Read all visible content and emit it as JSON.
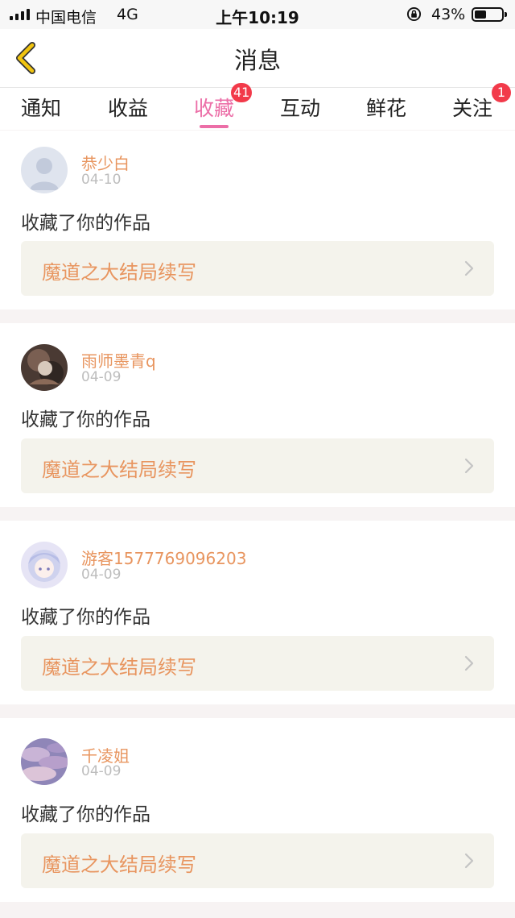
{
  "status_bar": {
    "carrier": "中国电信",
    "network": "4G",
    "time": "上午10:19",
    "battery_percent": "43%",
    "battery_level": 0.43
  },
  "header": {
    "title": "消息",
    "back_icon": "chevron-left-icon"
  },
  "tabs": [
    {
      "label": "通知",
      "active": false,
      "badge": ""
    },
    {
      "label": "收益",
      "active": false,
      "badge": ""
    },
    {
      "label": "收藏",
      "active": true,
      "badge": "41"
    },
    {
      "label": "互动",
      "active": false,
      "badge": ""
    },
    {
      "label": "鲜花",
      "active": false,
      "badge": ""
    },
    {
      "label": "关注",
      "active": false,
      "badge": "1"
    }
  ],
  "messages": [
    {
      "username": "恭少白",
      "date": "04-10",
      "action": "收藏了你的作品",
      "work_title": "魔道之大结局续写"
    },
    {
      "username": "雨师墨青q",
      "date": "04-09",
      "action": "收藏了你的作品",
      "work_title": "魔道之大结局续写"
    },
    {
      "username": "游客1577769096203",
      "date": "04-09",
      "action": "收藏了你的作品",
      "work_title": "魔道之大结局续写"
    },
    {
      "username": "千凌姐",
      "date": "04-09",
      "action": "收藏了你的作品",
      "work_title": "魔道之大结局续写"
    }
  ],
  "colors": {
    "accent_pink": "#ec6ea7",
    "name_orange": "#e8955f",
    "badge_red": "#f23a4a",
    "back_yellow": "#f1c40f"
  }
}
